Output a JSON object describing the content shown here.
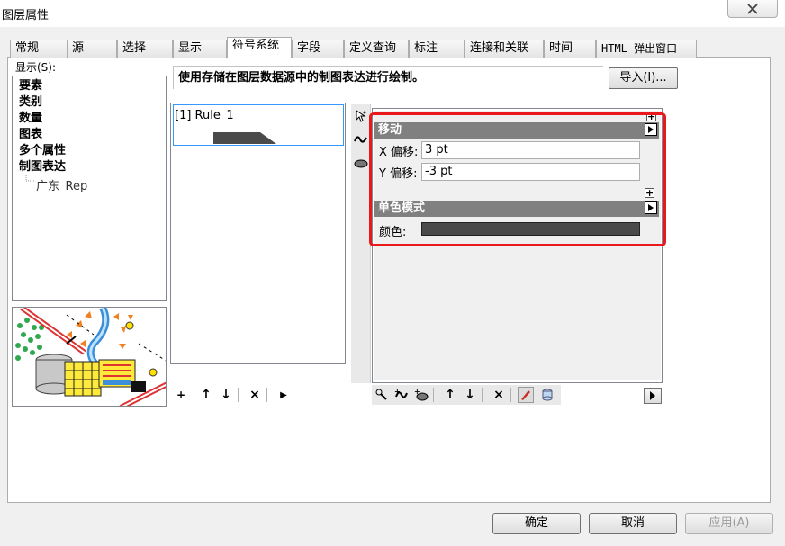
{
  "window": {
    "title": "图层属性"
  },
  "tabs": [
    {
      "label": "常规"
    },
    {
      "label": "源"
    },
    {
      "label": "选择"
    },
    {
      "label": "显示"
    },
    {
      "label": "符号系统"
    },
    {
      "label": "字段"
    },
    {
      "label": "定义查询"
    },
    {
      "label": "标注"
    },
    {
      "label": "连接和关联"
    },
    {
      "label": "时间"
    },
    {
      "label": "HTML 弹出窗口"
    }
  ],
  "active_tab": "符号系统",
  "show": {
    "label": "显示(S):",
    "items": [
      "要素",
      "类别",
      "数量",
      "图表",
      "多个属性",
      "制图表达"
    ],
    "child": "广东_Rep"
  },
  "description": "使用存储在图层数据源中的制图表达进行绘制。",
  "import_button": "导入(I)...",
  "rules": [
    {
      "label": "[1] Rule_1"
    }
  ],
  "move_section": {
    "title": "移动",
    "x_label": "X 偏移:",
    "x_value": "3 pt",
    "y_label": "Y 偏移:",
    "y_value": "-3 pt"
  },
  "color_section": {
    "title": "单色模式",
    "color_label": "颜色:",
    "color_value": "#4a4a4a"
  },
  "buttons": {
    "ok": "确定",
    "cancel": "取消",
    "apply": "应用(A)"
  },
  "colors": {
    "highlight": "#e8181c",
    "section_header": "#808080"
  },
  "icons": {
    "plus": "+",
    "up": "↑",
    "down": "↓",
    "delete": "×",
    "next": "▶"
  }
}
